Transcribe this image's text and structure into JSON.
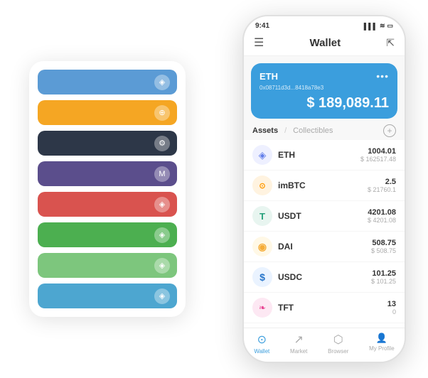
{
  "app": {
    "title": "Wallet"
  },
  "status_bar": {
    "time": "9:41",
    "signal": "▌▌▌",
    "wifi": "wifi",
    "battery": "battery"
  },
  "phone": {
    "header": {
      "menu_icon": "☰",
      "title": "Wallet",
      "expand_icon": "⇱"
    },
    "wallet_card": {
      "token": "ETH",
      "address": "0x08711d3d...8418a78e3",
      "amount": "$ 189,089.11",
      "currency_symbol": "$",
      "more_icon": "•••"
    },
    "assets": {
      "tab_active": "Assets",
      "tab_inactive": "Collectibles",
      "add_icon": "+"
    },
    "asset_list": [
      {
        "name": "ETH",
        "icon": "◈",
        "icon_color": "#627EEA",
        "amount": "1004.01",
        "usd": "$ 162517.48"
      },
      {
        "name": "imBTC",
        "icon": "⊕",
        "icon_color": "#FF9900",
        "amount": "2.5",
        "usd": "$ 21760.1"
      },
      {
        "name": "USDT",
        "icon": "T",
        "icon_color": "#26A17B",
        "amount": "4201.08",
        "usd": "$ 4201.08"
      },
      {
        "name": "DAI",
        "icon": "◎",
        "icon_color": "#F5AC37",
        "amount": "508.75",
        "usd": "$ 508.75"
      },
      {
        "name": "USDC",
        "icon": "◉",
        "icon_color": "#2775CA",
        "amount": "101.25",
        "usd": "$ 101.25"
      },
      {
        "name": "TFT",
        "icon": "❧",
        "icon_color": "#E84393",
        "amount": "13",
        "usd": "0"
      }
    ],
    "footer": [
      {
        "label": "Wallet",
        "active": true,
        "icon": "⊙"
      },
      {
        "label": "Market",
        "active": false,
        "icon": "↗"
      },
      {
        "label": "Browser",
        "active": false,
        "icon": "⬡"
      },
      {
        "label": "My Profile",
        "active": false,
        "icon": "👤"
      }
    ]
  },
  "bg_rows": [
    {
      "color": "#5B9BD5",
      "class": "row-blue",
      "icon": "◈"
    },
    {
      "color": "#F5A623",
      "class": "row-orange",
      "icon": "⊕"
    },
    {
      "color": "#2D3748",
      "class": "row-dark",
      "icon": "⚙"
    },
    {
      "color": "#5B4E8C",
      "class": "row-purple",
      "icon": "M"
    },
    {
      "color": "#D9534F",
      "class": "row-red",
      "icon": "◈"
    },
    {
      "color": "#4CAF50",
      "class": "row-green",
      "icon": "◈"
    },
    {
      "color": "#7DC67D",
      "class": "row-lightgreen",
      "icon": "◈"
    },
    {
      "color": "#4DA6D0",
      "class": "row-lightblue",
      "icon": "◈"
    }
  ]
}
